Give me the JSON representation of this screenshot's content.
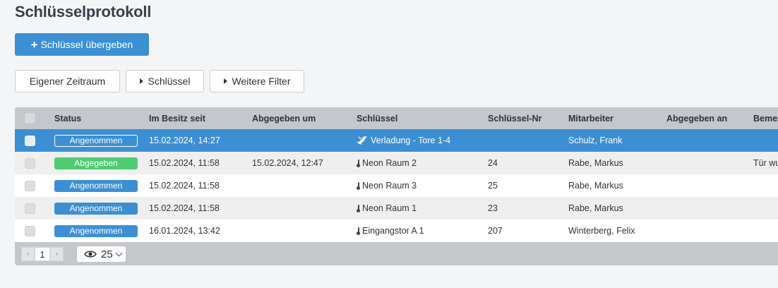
{
  "page": {
    "title": "Schlüsselprotokoll"
  },
  "toolbar": {
    "handover_label": "Schlüssel übergeben"
  },
  "filters": {
    "custom_range": "Eigener Zeitraum",
    "keys": "Schlüssel",
    "more": "Weitere Filter"
  },
  "table": {
    "columns": [
      "Status",
      "Im Besitz seit",
      "Abgegeben um",
      "Schlüssel",
      "Schlüssel-Nr",
      "Mitarbeiter",
      "Abgegeben an",
      "Bemer"
    ],
    "rows": [
      {
        "status": "Angenommen",
        "since": "15.02.2024, 14:27",
        "returned": "",
        "key": "Verladung - Tore 1-4",
        "key_icon": "bird-icon",
        "key_no": "",
        "employee": "Schulz, Frank",
        "returned_to": "",
        "note": ""
      },
      {
        "status": "Abgegeben",
        "since": "15.02.2024, 11:58",
        "returned": "15.02.2024, 12:47",
        "key": "Neon Raum 2",
        "key_icon": "thermometer-icon",
        "key_no": "24",
        "employee": "Rabe, Markus",
        "returned_to": "",
        "note": "Tür wu"
      },
      {
        "status": "Angenommen",
        "since": "15.02.2024, 11:58",
        "returned": "",
        "key": "Neon Raum 3",
        "key_icon": "thermometer-icon",
        "key_no": "25",
        "employee": "Rabe, Markus",
        "returned_to": "",
        "note": ""
      },
      {
        "status": "Angenommen",
        "since": "15.02.2024, 11:58",
        "returned": "",
        "key": "Neon Raum 1",
        "key_icon": "thermometer-icon",
        "key_no": "23",
        "employee": "Rabe, Markus",
        "returned_to": "",
        "note": ""
      },
      {
        "status": "Angenommen",
        "since": "16.01.2024, 13:42",
        "returned": "",
        "key": "Eingangstor A 1",
        "key_icon": "thermometer-icon",
        "key_no": "207",
        "employee": "Winterberg, Felix",
        "returned_to": "",
        "note": ""
      }
    ]
  },
  "pagination": {
    "prev": "‹",
    "page": "1",
    "next": "›",
    "per_page": "25",
    "view_icon": "eye-icon"
  },
  "colors": {
    "primary": "#3d8fd3",
    "success": "#4ecb71",
    "header_bg": "#c4c7cb"
  }
}
